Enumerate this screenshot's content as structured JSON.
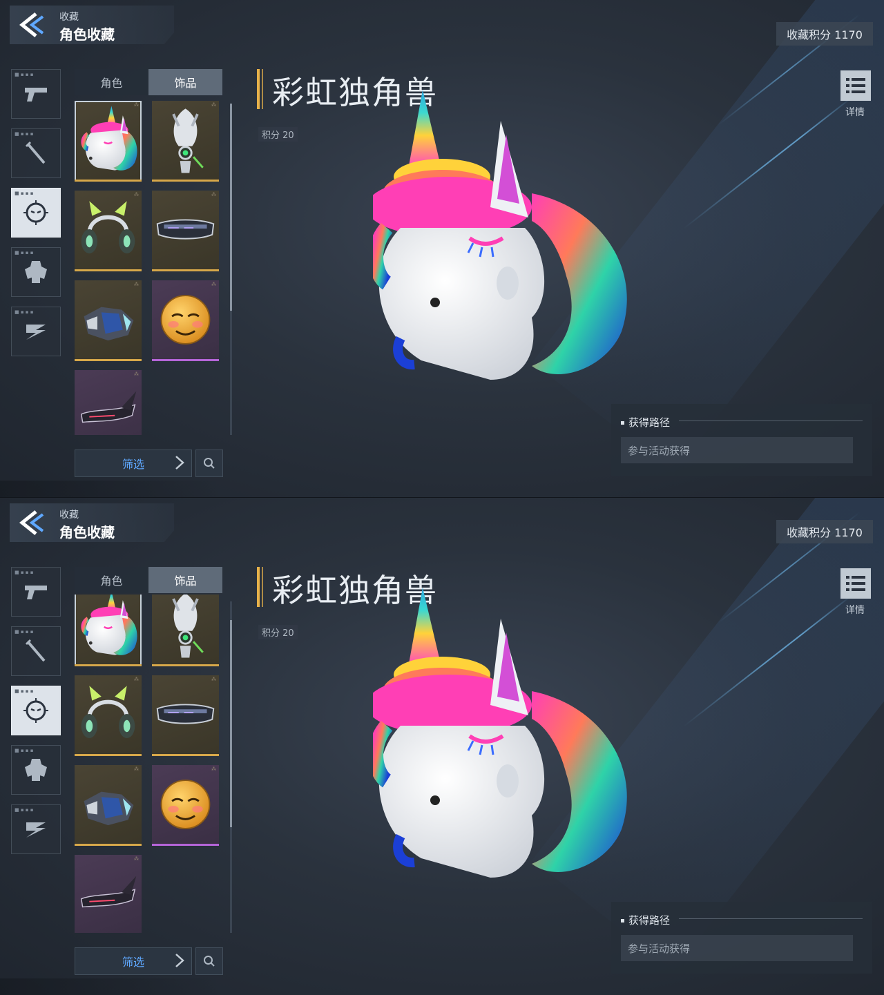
{
  "header": {
    "breadcrumb": "收藏",
    "title": "角色收藏",
    "points_label": "收藏积分 1170"
  },
  "category_sidebar": {
    "items": [
      {
        "icon": "pistol-icon",
        "active": false
      },
      {
        "icon": "melee-weapon-icon",
        "active": false
      },
      {
        "icon": "head-accessory-icon",
        "active": true
      },
      {
        "icon": "mech-body-icon",
        "active": false
      },
      {
        "icon": "emote-pose-icon",
        "active": false
      }
    ]
  },
  "tabs": [
    {
      "label": "角色",
      "active": false
    },
    {
      "label": "饰品",
      "active": true
    }
  ],
  "items": [
    {
      "icon": "unicorn-head-icon",
      "rarity": "gold",
      "selected": true
    },
    {
      "icon": "mechanical-mask-icon",
      "rarity": "gold",
      "selected": false
    },
    {
      "icon": "cat-ear-headphones-icon",
      "rarity": "gold",
      "selected": false
    },
    {
      "icon": "visor-glasses-icon",
      "rarity": "gold",
      "selected": false
    },
    {
      "icon": "armored-gauntlet-icon",
      "rarity": "gold",
      "selected": false
    },
    {
      "icon": "smug-emoji-ball-icon",
      "rarity": "purple",
      "selected": false
    },
    {
      "icon": "horned-visor-icon",
      "rarity": "purple",
      "selected": false
    }
  ],
  "filter": {
    "label": "筛选"
  },
  "detail": {
    "name": "彩虹独角兽",
    "points": "积分 20",
    "detail_label": "详情"
  },
  "acquisition": {
    "title": "获得路径",
    "value": "参与活动获得"
  },
  "colors": {
    "gold": "#d7a84a",
    "purple": "#b565d8",
    "accent_blue": "#5fa8ff",
    "name_bar": "#e8b24a"
  },
  "states": [
    {
      "label": "top-screenshot",
      "grid_scroll_fraction": 0.0
    },
    {
      "label": "bottom-screenshot",
      "grid_scroll_fraction": 0.15
    }
  ]
}
